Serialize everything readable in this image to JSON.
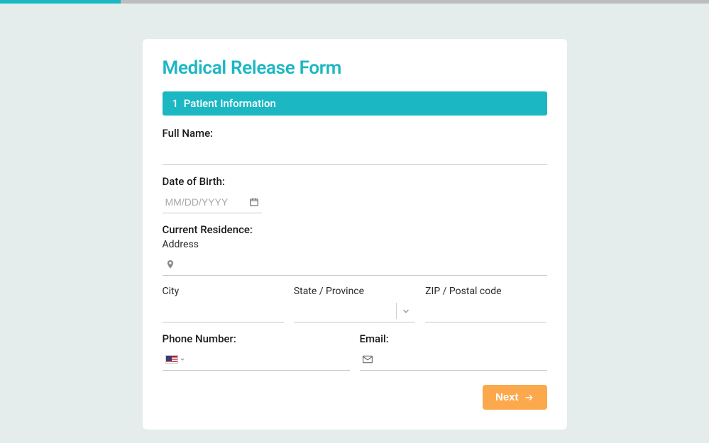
{
  "progress": {
    "percent": 17
  },
  "form": {
    "title": "Medical Release Form",
    "section": {
      "number": "1",
      "label": "Patient Information"
    },
    "fullName": {
      "label": "Full Name:",
      "value": ""
    },
    "dob": {
      "label": "Date of Birth:",
      "placeholder": "MM/DD/YYYY",
      "value": ""
    },
    "residence": {
      "label": "Current Residence:",
      "addressLabel": "Address",
      "addressValue": "",
      "cityLabel": "City",
      "cityValue": "",
      "stateLabel": "State / Province",
      "stateValue": "",
      "zipLabel": "ZIP / Postal code",
      "zipValue": ""
    },
    "phone": {
      "label": "Phone Number:",
      "value": "",
      "country": "US"
    },
    "email": {
      "label": "Email:",
      "value": ""
    },
    "nextLabel": "Next"
  }
}
